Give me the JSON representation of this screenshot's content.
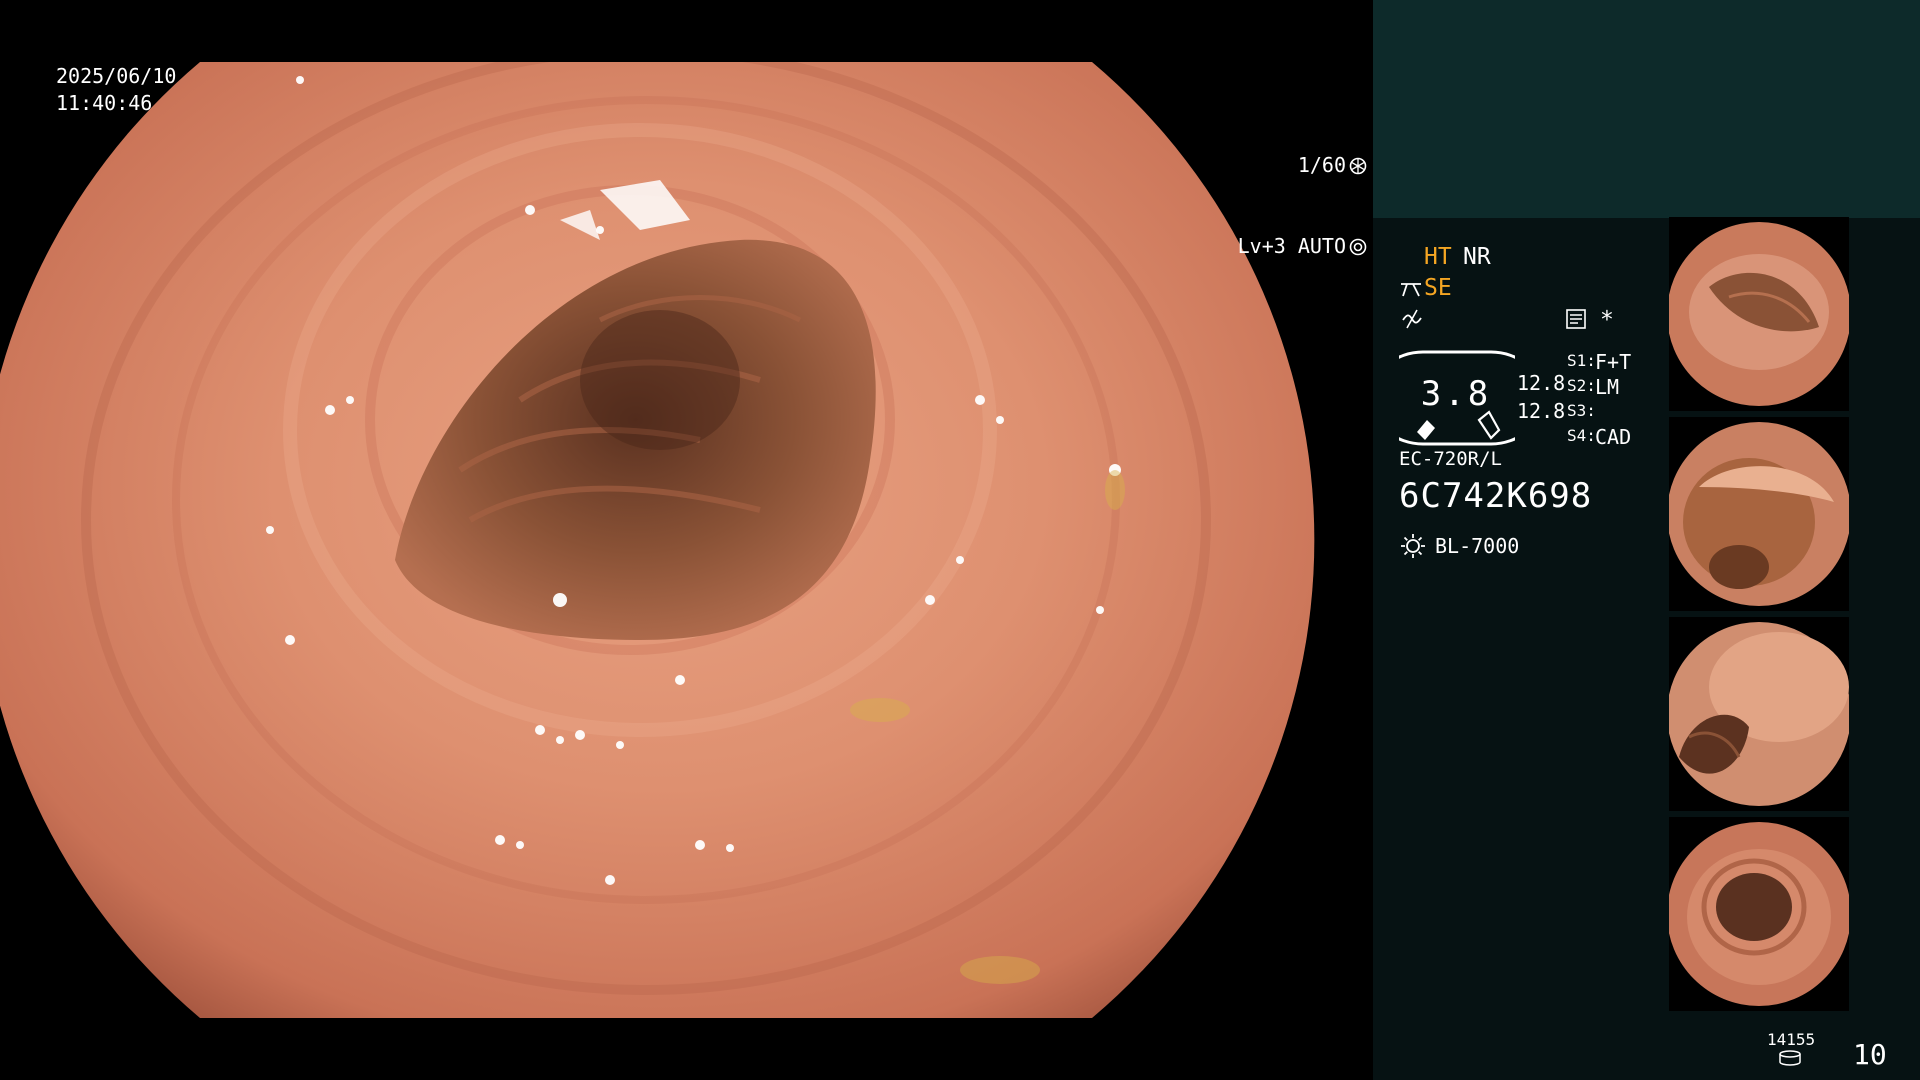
{
  "overlay": {
    "date": "2025/06/10",
    "time": "11:40:46",
    "shutter": "1/60",
    "level": "Lv+3 AUTO"
  },
  "panel": {
    "ht": "HT",
    "nr": "NR",
    "se": "SE",
    "gauge_value": "3.8",
    "value_a": "12.8",
    "value_b": "12.8",
    "s1_key": "S1:",
    "s1_val": "F+T",
    "s2_key": "S2:",
    "s2_val": "LM",
    "s3_key": "S3:",
    "s3_val": "",
    "s4_key": "S4:",
    "s4_val": "CAD",
    "asterisk": "*",
    "scope_model": "EC-720R/L",
    "serial": "6C742K698",
    "light_source": "BL-7000",
    "storage_remaining": "14155",
    "page_count": "10"
  },
  "colors": {
    "accent_orange": "#f5a623",
    "panel_bg": "#061213",
    "panel_top_bg": "#0d2a2a",
    "tissue": "#d98a6a"
  },
  "icons": [
    "aperture-icon",
    "iris-icon",
    "scissors-icon",
    "tilde-icon",
    "memo-icon",
    "lamp-icon",
    "drive-icon"
  ]
}
